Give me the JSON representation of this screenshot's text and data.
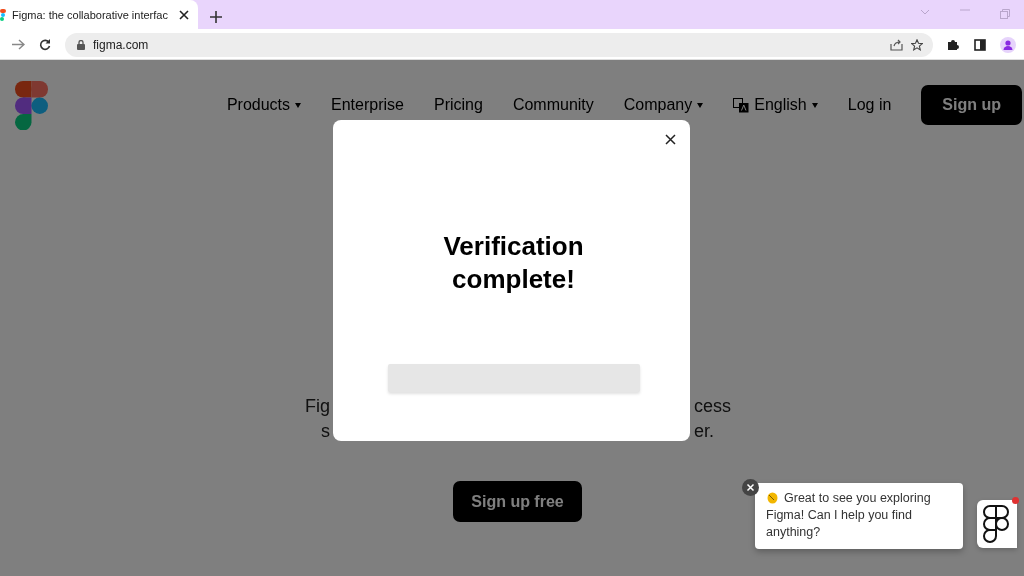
{
  "browser": {
    "tabs": [
      {
        "title": "Figma: the collaborative interfac",
        "selected": true
      }
    ],
    "url": "figma.com"
  },
  "nav": {
    "items": [
      {
        "label": "Products",
        "caret": true
      },
      {
        "label": "Enterprise",
        "caret": false
      },
      {
        "label": "Pricing",
        "caret": false
      },
      {
        "label": "Community",
        "caret": false
      },
      {
        "label": "Company",
        "caret": true
      }
    ],
    "language": "English",
    "login": "Log in",
    "signup": "Sign up"
  },
  "hero": {
    "lines": [
      {
        "left": "Fig",
        "right": "cess"
      },
      {
        "left": "s",
        "right": "er."
      }
    ],
    "cta": "Sign up free"
  },
  "modal": {
    "heading": "Verification complete!"
  },
  "chat": {
    "message": "Great to see you exploring Figma! Can I help you find anything?",
    "unread": true
  }
}
